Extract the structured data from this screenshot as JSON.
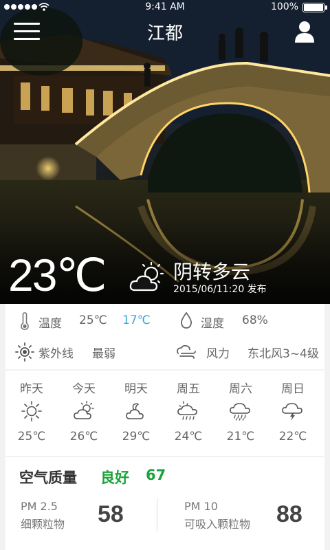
{
  "status_bar": {
    "time": "9:41 AM",
    "battery": "100%"
  },
  "nav": {
    "city": "江都"
  },
  "current": {
    "temperature": "23℃",
    "condition": "阴转多云",
    "published": "2015/06/11:20 发布",
    "condition_icon": "partly-cloudy-sun-icon"
  },
  "details": {
    "temperature": {
      "label": "温度",
      "high": "25℃",
      "low": "17℃"
    },
    "humidity": {
      "label": "湿度",
      "value": "68%"
    },
    "uv": {
      "label": "紫外线",
      "value": "最弱"
    },
    "wind": {
      "label": "风力",
      "value": "东北风3~4级"
    }
  },
  "forecast": [
    {
      "day": "昨天",
      "icon": "sun-icon",
      "temp": "25℃"
    },
    {
      "day": "今天",
      "icon": "sun-cloud-icon",
      "temp": "26℃"
    },
    {
      "day": "明天",
      "icon": "moon-cloud-icon",
      "temp": "29℃"
    },
    {
      "day": "周五",
      "icon": "storm-icon",
      "temp": "24℃"
    },
    {
      "day": "周六",
      "icon": "rain-icon",
      "temp": "21℃"
    },
    {
      "day": "周日",
      "icon": "thunder-icon",
      "temp": "22℃"
    }
  ],
  "air": {
    "title": "空气质量",
    "level": "良好",
    "aqi": "67",
    "pm25": {
      "name": "PM 2.5",
      "desc": "细颗粒物",
      "value": "58"
    },
    "pm10": {
      "name": "PM 10",
      "desc": "可吸入颗粒物",
      "value": "88"
    }
  },
  "colors": {
    "good": "#1aa33a",
    "low_temp": "#3aa6d9"
  }
}
